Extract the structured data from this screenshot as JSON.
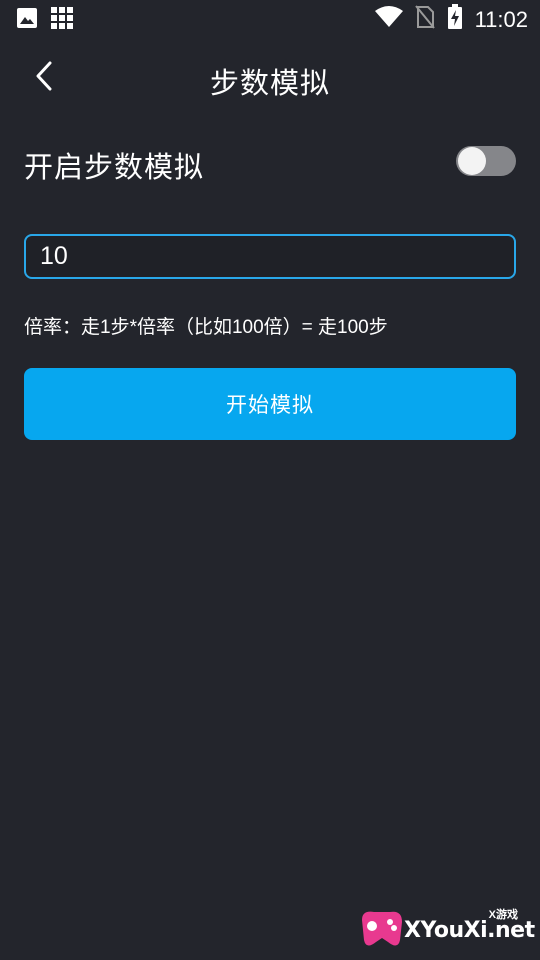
{
  "status_bar": {
    "time": "11:02",
    "icons": [
      "image-icon",
      "grid-icon",
      "wifi-icon",
      "no-sim-icon",
      "battery-charging-icon"
    ]
  },
  "header": {
    "back_icon": "chevron-left-icon",
    "title": "步数模拟"
  },
  "toggle": {
    "label": "开启步数模拟",
    "state": "off"
  },
  "input": {
    "value": "10"
  },
  "hint": "倍率：走1步*倍率（比如100倍）= 走100步",
  "start_button": {
    "label": "开始模拟"
  },
  "colors": {
    "background": "#23252c",
    "accent": "#07a7ef",
    "input_border": "#29a7e9",
    "toggle_track": "#85868a"
  },
  "watermark": {
    "text": "XYouXi.net",
    "small": "X游戏"
  }
}
